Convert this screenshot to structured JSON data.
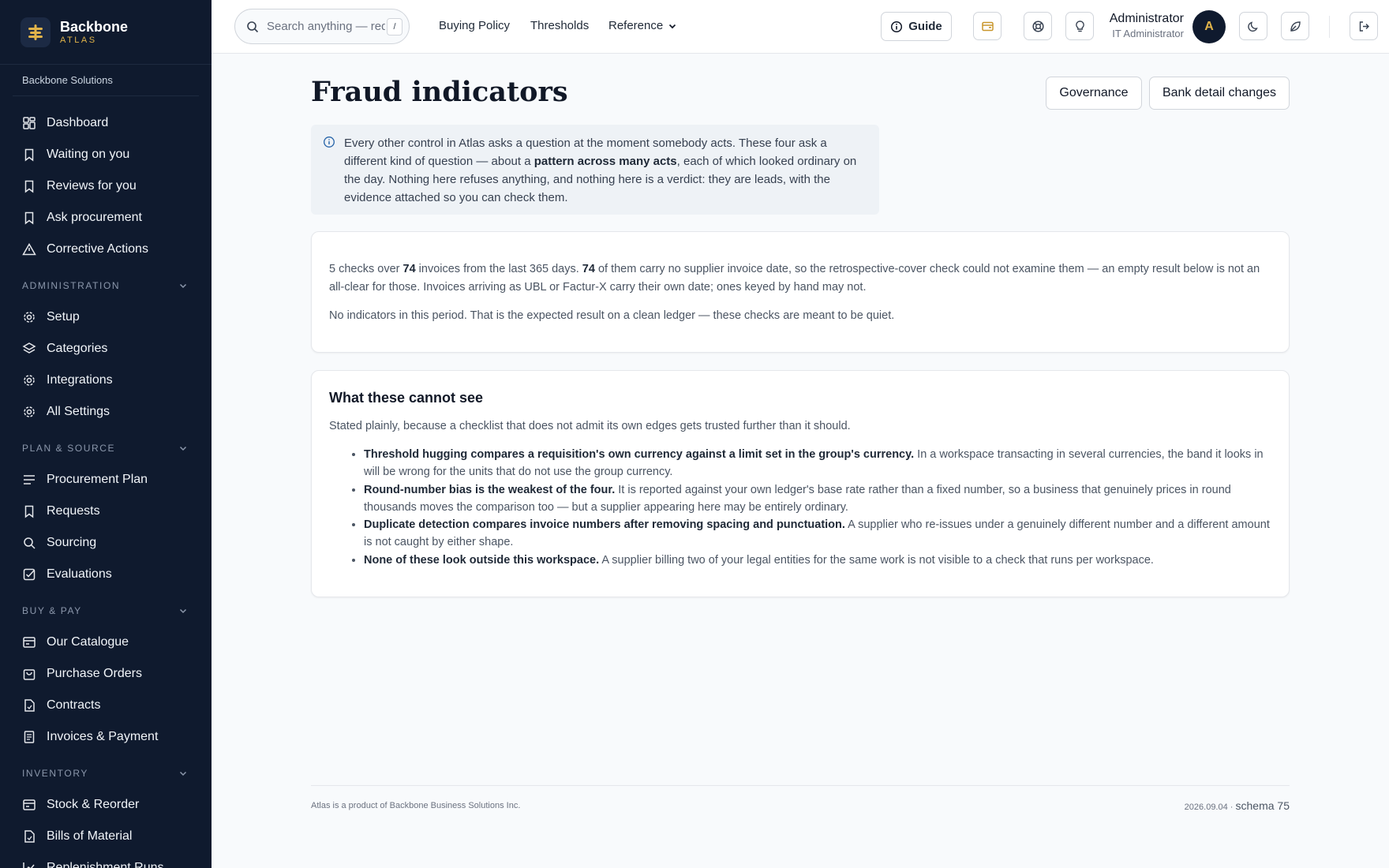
{
  "brand": {
    "name": "Backbone",
    "sub": "ATLAS",
    "org": "Backbone Solutions"
  },
  "sidebar": {
    "top_items": [
      {
        "label": "Dashboard",
        "icon": "dashboard-icon"
      },
      {
        "label": "Waiting on you",
        "icon": "bookmark-icon"
      },
      {
        "label": "Reviews for you",
        "icon": "bookmark-icon"
      },
      {
        "label": "Ask procurement",
        "icon": "bookmark-icon"
      },
      {
        "label": "Corrective Actions",
        "icon": "warning-icon"
      }
    ],
    "administration": {
      "title": "ADMINISTRATION",
      "items": [
        {
          "label": "Setup",
          "icon": "gear-icon"
        },
        {
          "label": "Categories",
          "icon": "layers-icon"
        },
        {
          "label": "Integrations",
          "icon": "gear-icon"
        },
        {
          "label": "All Settings",
          "icon": "gear-icon"
        }
      ]
    },
    "plan_source": {
      "title": "PLAN & SOURCE",
      "items": [
        {
          "label": "Procurement Plan",
          "icon": "list-icon"
        },
        {
          "label": "Requests",
          "icon": "bookmark-icon"
        },
        {
          "label": "Sourcing",
          "icon": "search-icon"
        },
        {
          "label": "Evaluations",
          "icon": "checkbox-icon"
        }
      ]
    },
    "buy_pay": {
      "title": "BUY & PAY",
      "items": [
        {
          "label": "Our Catalogue",
          "icon": "catalogue-icon"
        },
        {
          "label": "Purchase Orders",
          "icon": "bag-icon"
        },
        {
          "label": "Contracts",
          "icon": "document-icon"
        },
        {
          "label": "Invoices & Payment",
          "icon": "receipt-icon"
        }
      ]
    },
    "inventory": {
      "title": "INVENTORY",
      "items": [
        {
          "label": "Stock & Reorder",
          "icon": "catalogue-icon"
        },
        {
          "label": "Bills of Material",
          "icon": "document-icon"
        },
        {
          "label": "Replenishment Runs",
          "icon": "chart-icon"
        }
      ]
    }
  },
  "topbar": {
    "search_placeholder": "Search anything — req",
    "search_shortcut": "/",
    "nav": [
      "Buying Policy",
      "Thresholds",
      "Reference"
    ],
    "guide_label": "Guide",
    "user_name": "Administrator",
    "user_role": "IT Administrator",
    "avatar_letter": "A"
  },
  "page": {
    "title": "Fraud indicators",
    "buttons": [
      "Governance",
      "Bank detail changes"
    ],
    "info": {
      "part1": "Every other control in Atlas asks a question at the moment somebody acts. These four ask a different kind of question — about a ",
      "bold": "pattern across many acts",
      "part2": ", each of which looked ordinary on the day. Nothing here refuses anything, and nothing here is a verdict: they are leads, with the evidence attached so you can check them."
    },
    "summary": {
      "p1_a": "5 checks over ",
      "p1_count1": "74",
      "p1_b": " invoices from the last 365 days. ",
      "p1_count2": "74",
      "p1_c": " of them carry no supplier invoice date, so the retrospective-cover check could not examine them — an empty result below is not an all-clear for those. Invoices arriving as UBL or Factur-X carry their own date; ones keyed by hand may not.",
      "p2": "No indicators in this period. That is the expected result on a clean ledger — these checks are meant to be quiet."
    },
    "limits": {
      "title": "What these cannot see",
      "lead": "Stated plainly, because a checklist that does not admit its own edges gets trusted further than it should.",
      "items": [
        {
          "bold": "Threshold hugging compares a requisition's own currency against a limit set in the group's currency.",
          "text": " In a workspace transacting in several currencies, the band it looks in will be wrong for the units that do not use the group currency."
        },
        {
          "bold": "Round-number bias is the weakest of the four.",
          "text": " It is reported against your own ledger's base rate rather than a fixed number, so a business that genuinely prices in round thousands moves the comparison too — but a supplier appearing here may be entirely ordinary."
        },
        {
          "bold": "Duplicate detection compares invoice numbers after removing spacing and punctuation.",
          "text": " A supplier who re-issues under a genuinely different number and a different amount is not caught by either shape."
        },
        {
          "bold": "None of these look outside this workspace.",
          "text": " A supplier billing two of your legal entities for the same work is not visible to a check that runs per workspace."
        }
      ]
    }
  },
  "footer": {
    "left": "Atlas is a product of Backbone Business Solutions Inc.",
    "version": "2026.09.04 ·",
    "schema": "schema 75"
  },
  "colors": {
    "sidebar_bg": "#0f1a2e",
    "accent": "#e0b34a"
  }
}
